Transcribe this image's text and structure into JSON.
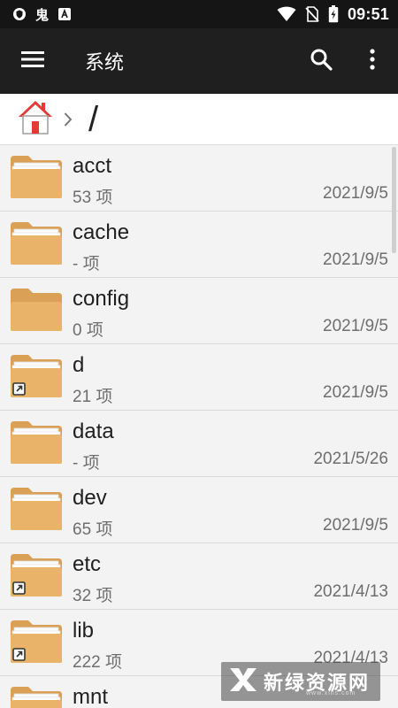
{
  "status_bar": {
    "time": "09:51",
    "ghost_glyph": "鬼",
    "icons": [
      "shield-icon",
      "ghost-icon",
      "a-box-icon",
      "wifi-icon",
      "no-sim-icon",
      "battery-charging-icon"
    ]
  },
  "app_bar": {
    "title": "系统",
    "icons": [
      "menu-icon",
      "search-icon",
      "more-vert-icon"
    ]
  },
  "breadcrumb": {
    "path": "/",
    "icons": [
      "home-icon",
      "chevron-right-icon"
    ]
  },
  "files": [
    {
      "name": "acct",
      "count": "53 项",
      "date": "2021/9/5",
      "symlink": false,
      "variant": "full"
    },
    {
      "name": "cache",
      "count": "- 项",
      "date": "2021/9/5",
      "symlink": false,
      "variant": "full"
    },
    {
      "name": "config",
      "count": "0 项",
      "date": "2021/9/5",
      "symlink": false,
      "variant": "empty"
    },
    {
      "name": "d",
      "count": "21 项",
      "date": "2021/9/5",
      "symlink": true,
      "variant": "full"
    },
    {
      "name": "data",
      "count": "- 项",
      "date": "2021/5/26",
      "symlink": false,
      "variant": "full"
    },
    {
      "name": "dev",
      "count": "65 项",
      "date": "2021/9/5",
      "symlink": false,
      "variant": "full"
    },
    {
      "name": "etc",
      "count": "32 项",
      "date": "2021/4/13",
      "symlink": true,
      "variant": "full"
    },
    {
      "name": "lib",
      "count": "222 项",
      "date": "2021/4/13",
      "symlink": true,
      "variant": "full"
    },
    {
      "name": "mnt",
      "count": "",
      "date": "",
      "symlink": false,
      "variant": "full"
    }
  ],
  "watermark": {
    "text": "新绿资源网",
    "sub": "www.xlhs.com"
  },
  "colors": {
    "folder_body": "#e9b46a",
    "folder_back": "#d9a056",
    "paper": "#fbfbfb",
    "app_bar": "#1f1f1f",
    "home_roof": "#e53935"
  }
}
